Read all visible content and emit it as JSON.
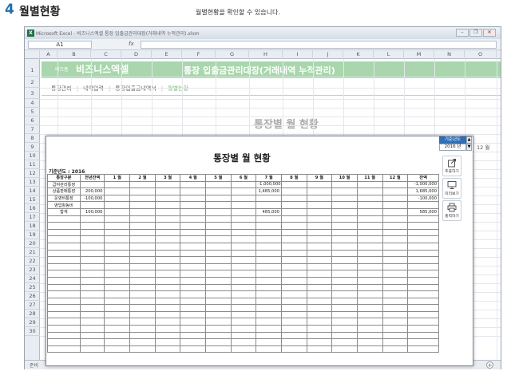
{
  "heading": {
    "number": "4",
    "title": "월별현황",
    "caption": "월별현황을 확인할 수 있습니다."
  },
  "window": {
    "title": "Microsoft Excel - 비즈니스엑셀 통장 입출금관리대장(거래내역 누적관리).xlsm",
    "minimize": "–",
    "restore": "❐",
    "close": "✕"
  },
  "formula_bar": {
    "cell_ref": "A1",
    "fx": "fx",
    "value": ""
  },
  "columns": [
    "A",
    "B",
    "C",
    "D",
    "E",
    "F",
    "G",
    "H",
    "I",
    "J",
    "K",
    "L",
    "M",
    "N",
    "O"
  ],
  "rows": [
    "1",
    "2",
    "3",
    "4",
    "5",
    "6",
    "7",
    "8",
    "9",
    "10",
    "11",
    "12",
    "13",
    "14",
    "15",
    "16",
    "17",
    "18",
    "19",
    "20",
    "21",
    "22",
    "23",
    "24",
    "25",
    "26",
    "27",
    "28",
    "29",
    "30"
  ],
  "sheet": {
    "brand_small": "비즈폼",
    "brand": "비즈니스엑셀",
    "title": "통장 입출금관리대장(거래내역 누적관리)",
    "nav": [
      "통장관리",
      "내역입력",
      "통장입출금내역서",
      "월별현황"
    ],
    "bg_title": "통장별 월 현황",
    "row8_text": "12 월",
    "sheet_tab": "준비"
  },
  "modal": {
    "title": "통장별 월 현황",
    "year_label": "기준년도 : 2016",
    "year_box_label": "기준년도",
    "year_value": "2016 년",
    "headers": [
      "통장구분",
      "전년잔액",
      "1 월",
      "2 월",
      "3 월",
      "4 월",
      "5 월",
      "6 월",
      "7 월",
      "8 월",
      "9 월",
      "10 월",
      "11 월",
      "12 월",
      "잔액"
    ],
    "rows": [
      [
        "급여관리통장",
        "",
        "",
        "",
        "",
        "",
        "",
        "",
        "-1,000,000",
        "",
        "",
        "",
        "",
        "",
        "-1,000,000"
      ],
      [
        "상품판매통장",
        "200,000",
        "",
        "",
        "",
        "",
        "",
        "",
        "1,485,000",
        "",
        "",
        "",
        "",
        "",
        "1,685,000"
      ],
      [
        "운영비통장",
        "-100,000",
        "",
        "",
        "",
        "",
        "",
        "",
        "",
        "",
        "",
        "",
        "",
        "",
        "-100,000"
      ],
      [
        "영업활동비",
        "",
        "",
        "",
        "",
        "",
        "",
        "",
        "",
        "",
        "",
        "",
        "",
        "",
        ""
      ],
      [
        "합계",
        "100,000",
        "",
        "",
        "",
        "",
        "",
        "",
        "485,000",
        "",
        "",
        "",
        "",
        "",
        "585,000"
      ]
    ],
    "empty_rows": 20,
    "buttons": [
      {
        "label": "추출하기",
        "icon": "export-icon"
      },
      {
        "label": "미리보기",
        "icon": "monitor-icon"
      },
      {
        "label": "출력하기",
        "icon": "printer-icon"
      }
    ]
  }
}
